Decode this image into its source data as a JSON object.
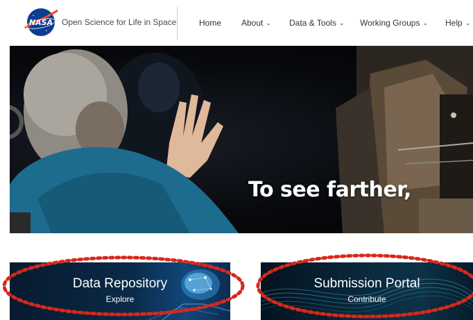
{
  "header": {
    "logo_text": "NASA",
    "brand": "Open Science for Life in Space",
    "nav": [
      {
        "label": "Home",
        "has_dropdown": false
      },
      {
        "label": "About",
        "has_dropdown": true
      },
      {
        "label": "Data & Tools",
        "has_dropdown": true
      },
      {
        "label": "Working Groups",
        "has_dropdown": true
      },
      {
        "label": "Help",
        "has_dropdown": true
      }
    ],
    "chevron_glyph": "⌄"
  },
  "hero": {
    "tagline": "To see farther,"
  },
  "cards": [
    {
      "title": "Data Repository",
      "subtitle": "Explore"
    },
    {
      "title": "Submission Portal",
      "subtitle": "Contribute"
    }
  ],
  "colors": {
    "annotation_red": "#d8281c",
    "nasa_blue": "#0b3d91",
    "nasa_red": "#fc3d21"
  }
}
